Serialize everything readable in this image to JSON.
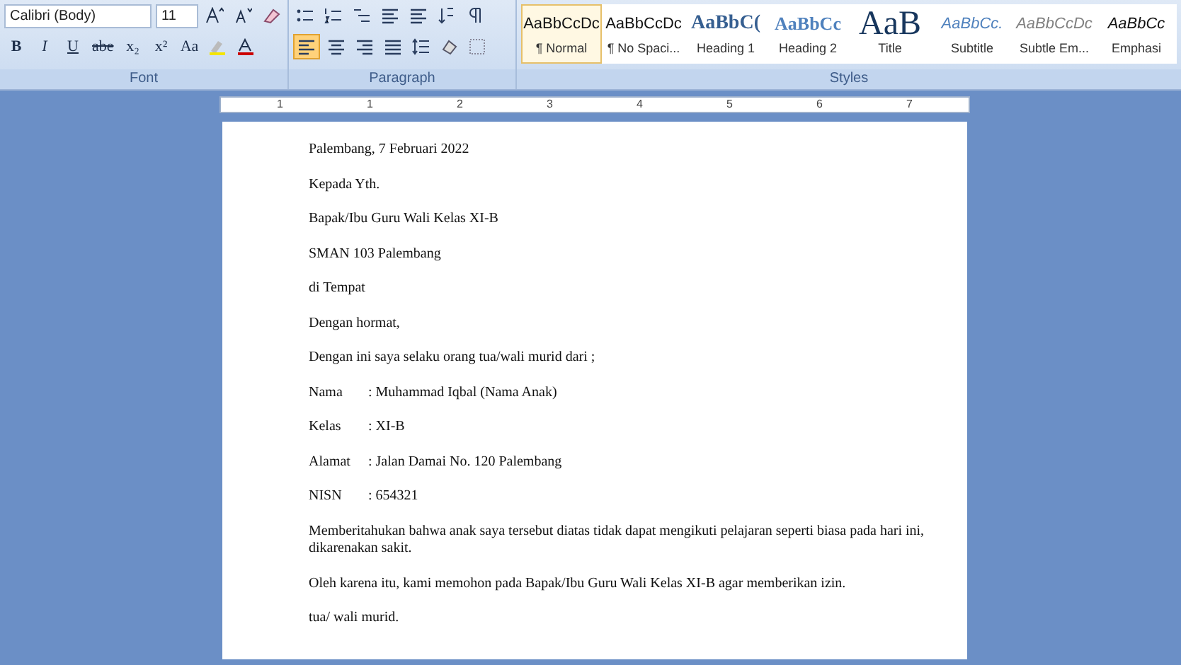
{
  "ribbon": {
    "font_group": {
      "label": "Font",
      "font_name": "Calibri (Body)",
      "font_size": "11",
      "format_buttons": [
        {
          "label": "B",
          "kind": "bold"
        },
        {
          "label": "I",
          "kind": "italic"
        },
        {
          "label": "U",
          "kind": "underline"
        },
        {
          "label": "abe",
          "kind": "strike"
        },
        {
          "label": "x₂",
          "kind": "plain"
        },
        {
          "label": "x²",
          "kind": "plain"
        },
        {
          "label": "Aa",
          "kind": "plain"
        }
      ]
    },
    "paragraph_group": {
      "label": "Paragraph",
      "alignments": [
        {
          "selected": true
        },
        {
          "selected": false
        },
        {
          "selected": false
        },
        {
          "selected": false
        }
      ]
    },
    "styles_group": {
      "label": "Styles",
      "styles": [
        {
          "preview": "AaBbCcDc",
          "name": "¶ Normal",
          "kind": "normal",
          "selected": true
        },
        {
          "preview": "AaBbCcDc",
          "name": "¶ No Spaci...",
          "kind": "normal",
          "selected": false
        },
        {
          "preview": "AaBbC(",
          "name": "Heading 1",
          "kind": "heading1",
          "selected": false
        },
        {
          "preview": "AaBbCc",
          "name": "Heading 2",
          "kind": "heading2",
          "selected": false
        },
        {
          "preview": "AaB",
          "name": "Title",
          "kind": "title",
          "selected": false
        },
        {
          "preview": "AaBbCc.",
          "name": "Subtitle",
          "kind": "subtitle",
          "selected": false
        },
        {
          "preview": "AaBbCcDc",
          "name": "Subtle Em...",
          "kind": "subtle",
          "selected": false
        },
        {
          "preview": "AaBbCc",
          "name": "Emphasi",
          "kind": "emphasis",
          "selected": false
        }
      ]
    }
  },
  "ruler": {
    "numbers": [
      "1",
      "1",
      "2",
      "3",
      "4",
      "5",
      "6",
      "7"
    ]
  },
  "document": {
    "paragraphs": [
      {
        "kind": "line",
        "text": "Palembang, 7 Februari 2022"
      },
      {
        "kind": "line",
        "text": "Kepada Yth."
      },
      {
        "kind": "line",
        "text": "Bapak/Ibu Guru Wali Kelas XI-B"
      },
      {
        "kind": "line",
        "text": "SMAN 103 Palembang"
      },
      {
        "kind": "line",
        "text": "di Tempat"
      },
      {
        "kind": "line",
        "text": "Dengan hormat,"
      },
      {
        "kind": "line",
        "text": "Dengan ini saya selaku orang tua/wali murid dari ;"
      },
      {
        "kind": "field",
        "label": "Nama",
        "value": ": Muhammad Iqbal (Nama Anak)"
      },
      {
        "kind": "field",
        "label": "Kelas",
        "value": ": XI-B"
      },
      {
        "kind": "field",
        "label": "Alamat",
        "value": ": Jalan Damai No. 120 Palembang"
      },
      {
        "kind": "field",
        "label": "NISN",
        "value": ": 654321"
      },
      {
        "kind": "line",
        "text": "Memberitahukan bahwa anak saya tersebut diatas tidak dapat mengikuti pelajaran seperti biasa pada hari ini,  dikarenakan sakit."
      },
      {
        "kind": "line",
        "text": "Oleh karena itu, kami memohon pada Bapak/Ibu Guru Wali Kelas XI-B agar memberikan izin."
      },
      {
        "kind": "line",
        "text": "tua/ wali murid."
      }
    ]
  }
}
